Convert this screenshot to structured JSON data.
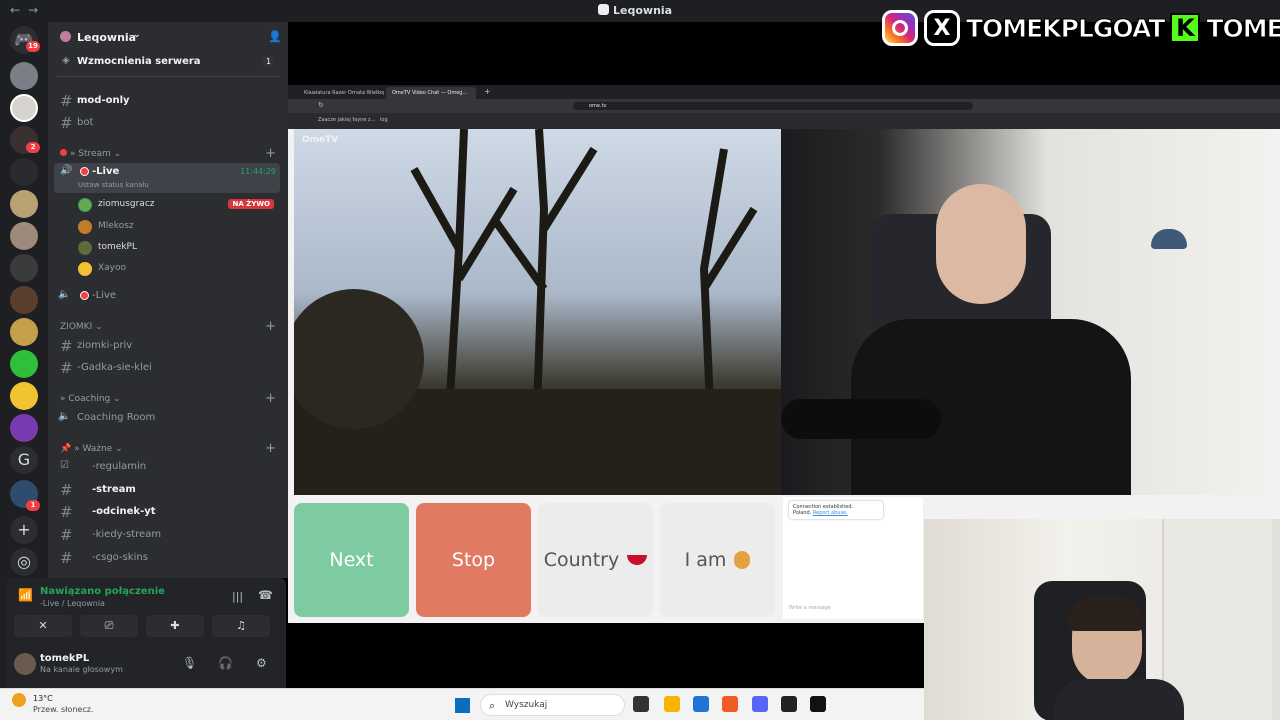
{
  "topbar": {
    "title": "Leqownia",
    "back_glyph": "←",
    "forward_glyph": "→"
  },
  "overlay": {
    "handle_main": "TOMEKPLGOAT",
    "handle_kick": "TOMEKPL",
    "kick_letter": "K",
    "x_letter": "X"
  },
  "server_bar": {
    "home_badge": "19",
    "badges": [
      "2",
      "1"
    ]
  },
  "server": {
    "name": "Leqownia",
    "boost_label": "Wzmocnienia serwera",
    "boost_count": "1"
  },
  "channels": {
    "mod_only": "mod-only",
    "bot": "bot",
    "cat_stream": "» Stream",
    "live_active": "-Live",
    "live_time": "11:44:29",
    "live_status": "Ustaw status kanału",
    "users": [
      {
        "name": "ziomusgracz",
        "color": "#6aa84f",
        "badge": "NA ŻYWO"
      },
      {
        "name": "Mlekosz",
        "color": "#c27c2c",
        "badge": ""
      },
      {
        "name": "tomekPL",
        "color": "#5b6b3a",
        "badge": ""
      },
      {
        "name": "Xayoo",
        "color": "#f1c232",
        "badge": ""
      }
    ],
    "live_second": "-Live",
    "cat_ziomki": "ZIOMKI",
    "ziomki_priv": "ziomki-priv",
    "gadka": "-Gadka-sie-klei",
    "cat_coaching": "» Coaching",
    "coaching_room": "Coaching Room",
    "cat_wazne": "Ważne",
    "regulamin": "-regulamin",
    "stream": "-stream",
    "odcinek": "-odcinek-yt",
    "kiedy": "-kiedy-stream",
    "csgo": "-csgo-skins"
  },
  "voice_panel": {
    "status": "Nawiązano połączenie",
    "channel": "-Live / Leqownia",
    "username": "tomekPL",
    "user_sub": "Na kanale głosowym"
  },
  "browser": {
    "tab1": "Klawiatura Razer Ornata Wielkopolsk...",
    "tab2": "OmeTV Video Chat — Omeg...",
    "url": "ome.tv",
    "bookmark1": "Zaacze jakiej fayne z...",
    "bookmark2": "log"
  },
  "ometv": {
    "logo": "OmeTV",
    "next": "Next",
    "stop": "Stop",
    "country": "Country",
    "iam": "I am",
    "chat_msg1": "Connection established.",
    "chat_msg2": "Poland.",
    "chat_report": "Report abuse.",
    "chat_placeholder": "Write a message",
    "colors": {
      "next": "#7ecba1",
      "stop": "#e07a62"
    }
  },
  "taskbar": {
    "temp": "13°C",
    "weather": "Przew. słonecz.",
    "search": "Wyszukaj"
  }
}
